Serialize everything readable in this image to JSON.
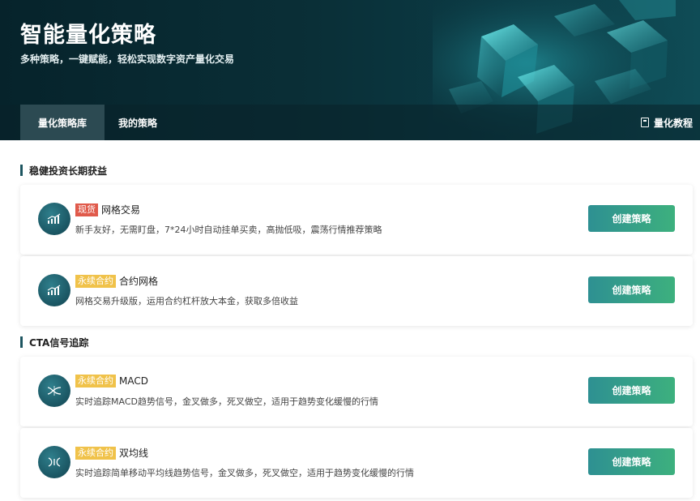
{
  "header": {
    "title": "智能量化策略",
    "subtitle": "多种策略，一键赋能，轻松实现数字资产量化交易",
    "tabs": [
      {
        "label": "量化策略库",
        "active": true
      },
      {
        "label": "我的策略",
        "active": false
      }
    ],
    "tutorial_label": "量化教程"
  },
  "sections": [
    {
      "title": "稳健投资长期获益",
      "items": [
        {
          "tag": "现货",
          "tag_color": "#e05a4b",
          "name": "网格交易",
          "desc": "新手友好，无需盯盘，7*24小时自动挂单买卖，高抛低吸，震荡行情推荐策略",
          "button": "创建策略",
          "icon": "bar-chart-icon"
        },
        {
          "tag": "永续合约",
          "tag_color": "#f0c24a",
          "name": "合约网格",
          "desc": "网格交易升级版，运用合约杠杆放大本金，获取多倍收益",
          "button": "创建策略",
          "icon": "bar-chart-icon"
        }
      ]
    },
    {
      "title": "CTA信号追踪",
      "items": [
        {
          "tag": "永续合约",
          "tag_color": "#f0c24a",
          "name": "MACD",
          "desc": "实时追踪MACD趋势信号，金叉做多，死叉做空，适用于趋势变化缓慢的行情",
          "button": "创建策略",
          "icon": "crossing-lines-icon"
        },
        {
          "tag": "永续合约",
          "tag_color": "#f0c24a",
          "name": "双均线",
          "desc": "实时追踪简单移动平均线趋势信号，金叉做多，死叉做空，适用于趋势变化缓慢的行情",
          "button": "创建策略",
          "icon": "double-line-icon"
        }
      ]
    }
  ]
}
